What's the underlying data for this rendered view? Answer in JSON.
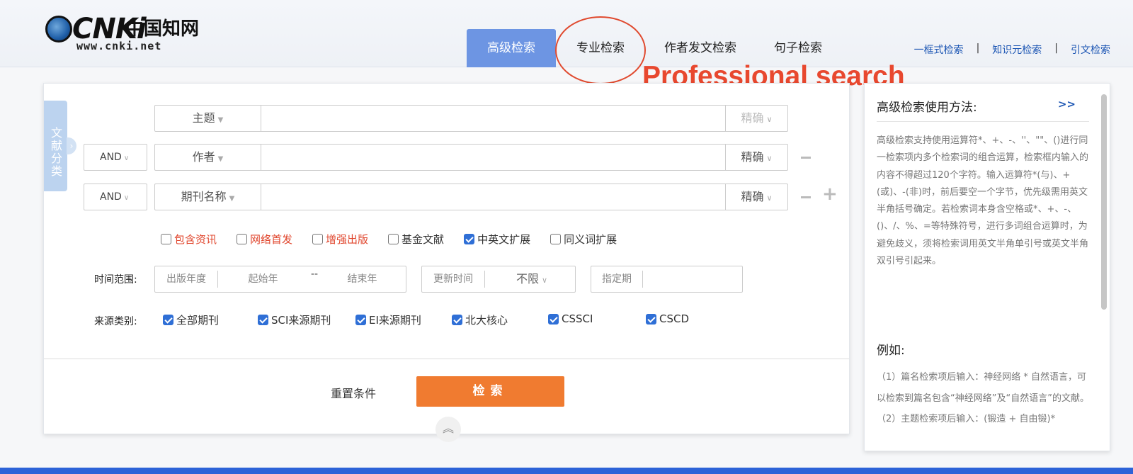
{
  "logo": {
    "brand": "CNKi",
    "cn": "中国知网",
    "url": "www.cnki.net"
  },
  "tabs": [
    {
      "label": "高级检索",
      "active": true
    },
    {
      "label": "专业检索",
      "active": false
    },
    {
      "label": "作者发文检索",
      "active": false
    },
    {
      "label": "句子检索",
      "active": false
    }
  ],
  "annotation": "Professional search",
  "top_links": [
    "一框式检索",
    "知识元检索",
    "引文检索"
  ],
  "side_tag": "文献分类",
  "fields": [
    {
      "op": "",
      "name": "主题",
      "match": "精确",
      "value": ""
    },
    {
      "op": "AND",
      "name": "作者",
      "match": "精确",
      "value": ""
    },
    {
      "op": "AND",
      "name": "期刊名称",
      "match": "精确",
      "value": ""
    }
  ],
  "options": [
    {
      "label": "包含资讯",
      "checked": false
    },
    {
      "label": "网络首发",
      "checked": false
    },
    {
      "label": "增强出版",
      "checked": false
    },
    {
      "label": "基金文献",
      "checked": false
    },
    {
      "label": "中英文扩展",
      "checked": true
    },
    {
      "label": "同义词扩展",
      "checked": false
    }
  ],
  "time": {
    "label": "时间范围:",
    "year_label": "出版年度",
    "start_placeholder": "起始年",
    "dash": "--",
    "end_placeholder": "结束年",
    "update_label": "更新时间",
    "update_value": "不限",
    "period_label": "指定期"
  },
  "source": {
    "label": "来源类别:",
    "items": [
      {
        "label": "全部期刊",
        "checked": true
      },
      {
        "label": "SCI来源期刊",
        "checked": true
      },
      {
        "label": "EI来源期刊",
        "checked": true
      },
      {
        "label": "北大核心",
        "checked": true
      },
      {
        "label": "CSSCI",
        "checked": true
      },
      {
        "label": "CSCD",
        "checked": true
      }
    ]
  },
  "actions": {
    "reset": "重置条件",
    "search": "检索"
  },
  "help": {
    "title": "高级检索使用方法:",
    "more": ">>",
    "body": "高级检索支持使用运算符*、+、-、''、\"\"、()进行同一检索项内多个检索词的组合运算，检索框内输入的内容不得超过120个字符。输入运算符*(与)、+(或)、-(非)时，前后要空一个字节，优先级需用英文半角括号确定。若检索词本身含空格或*、+、-、()、/、%、=等特殊符号，进行多词组合运算时，为避免歧义，须将检索词用英文半角单引号或英文半角双引号引起来。",
    "example_title": "例如:",
    "example_body": "（1）篇名检索项后输入：神经网络 * 自然语言，可以检索到篇名包含“神经网络”及“自然语言”的文献。（2）主题检索项后输入：(锻造 + 自由锻)*"
  },
  "colors": {
    "accent": "#6d95e3",
    "search_button": "#f07b30",
    "annotation": "#e8482f",
    "link": "#1b55b3"
  }
}
